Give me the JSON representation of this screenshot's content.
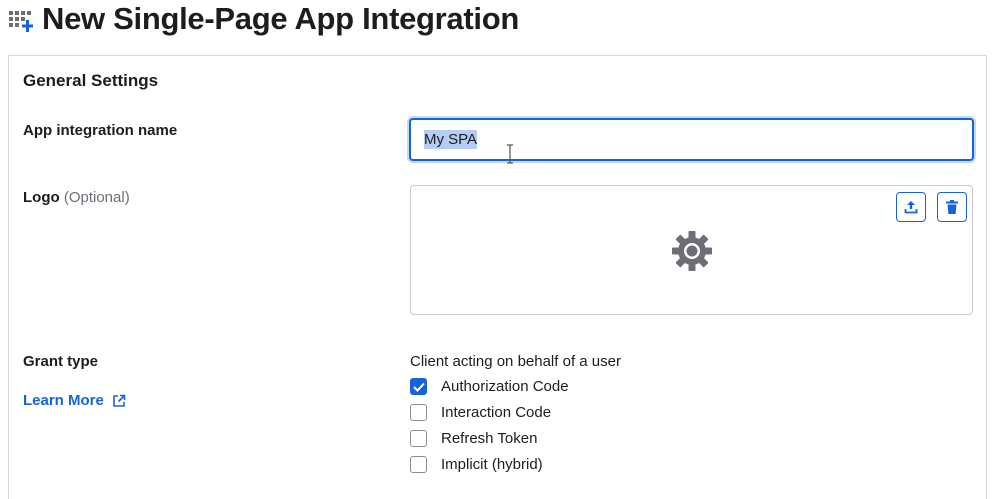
{
  "header": {
    "title": "New Single-Page App Integration",
    "icon": "app-grid-add-icon"
  },
  "general_settings": {
    "title": "General Settings",
    "app_name": {
      "label": "App integration name",
      "value": "My SPA"
    },
    "logo": {
      "label": "Logo",
      "optional": "(Optional)",
      "upload_icon": "upload-icon",
      "delete_icon": "trash-icon",
      "placeholder_icon": "gear-icon"
    },
    "grant_type": {
      "label": "Grant type",
      "learn_more": "Learn More",
      "client_label": "Client acting on behalf of a user",
      "options": [
        {
          "label": "Authorization Code",
          "checked": true
        },
        {
          "label": "Interaction Code",
          "checked": false
        },
        {
          "label": "Refresh Token",
          "checked": false
        },
        {
          "label": "Implicit (hybrid)",
          "checked": false
        }
      ]
    }
  },
  "colors": {
    "accent": "#1662dd",
    "text": "#1d1d21",
    "muted": "#6e6e78",
    "border": "#d7d7dc"
  }
}
